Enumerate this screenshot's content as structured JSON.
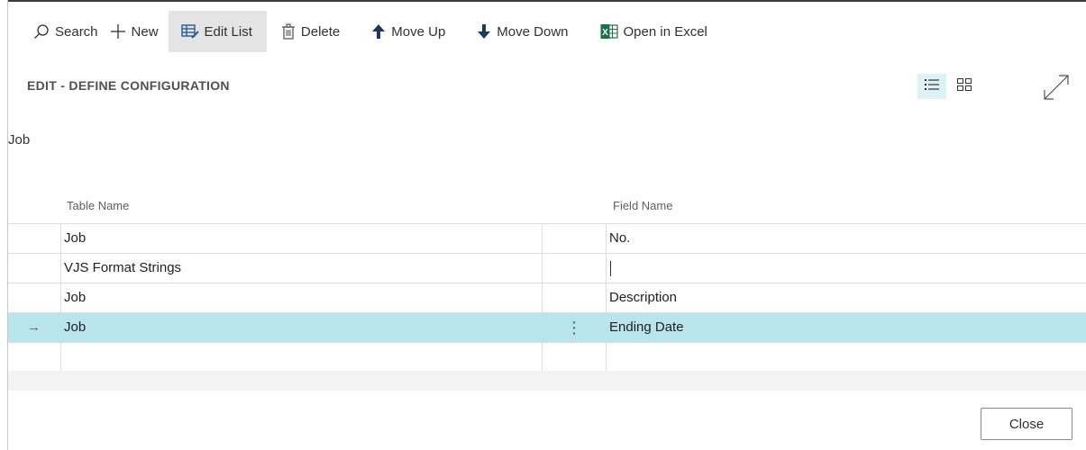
{
  "toolbar": {
    "search_label": "Search",
    "new_label": "New",
    "edit_list_label": "Edit List",
    "delete_label": "Delete",
    "move_up_label": "Move Up",
    "move_down_label": "Move Down",
    "open_excel_label": "Open in Excel"
  },
  "page": {
    "caption": "EDIT - DEFINE CONFIGURATION",
    "group_label": "Job"
  },
  "grid": {
    "headers": {
      "table_name": "Table Name",
      "field_name": "Field Name"
    },
    "rows": [
      {
        "table_name": "Job",
        "field_name": "No."
      },
      {
        "table_name": "VJS Format Strings",
        "field_name": ""
      },
      {
        "table_name": "Job",
        "field_name": "Description"
      },
      {
        "table_name": "Job",
        "field_name": "Ending Date",
        "selected": true,
        "row_marker": "→",
        "actions": "⋮"
      },
      {
        "table_name": "",
        "field_name": ""
      }
    ]
  },
  "footer": {
    "close_label": "Close"
  },
  "icons": {
    "search": "search-icon",
    "new": "plus-icon",
    "edit_list": "edit-list-icon",
    "delete": "trash-icon",
    "move_up": "arrow-up-icon",
    "move_down": "arrow-down-icon",
    "excel": "excel-icon",
    "list_view": "list-view-icon",
    "tile_view": "tile-view-icon",
    "expand": "expand-icon"
  },
  "colors": {
    "accent": "#00a3b4",
    "selected_row": "#b8e5ec",
    "excel_green": "#1e7145"
  }
}
